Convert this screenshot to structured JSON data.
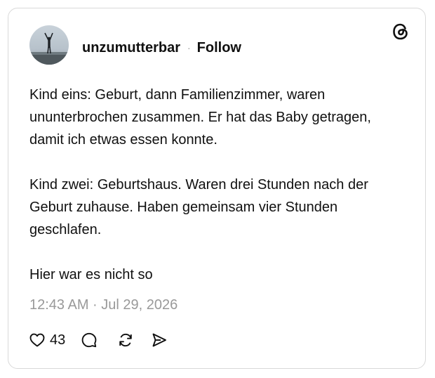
{
  "post": {
    "username": "unzumutterbar",
    "separator": "·",
    "follow_label": "Follow",
    "paragraphs": [
      "Kind eins: Geburt, dann Familienzimmer, waren ununterbrochen zusammen. Er hat das Baby getragen, damit ich etwas essen konnte.",
      "Kind zwei: Geburtshaus. Waren drei Stunden nach der Geburt zuhause. Haben gemeinsam vier Stunden geschlafen.",
      "Hier war es nicht so"
    ],
    "timestamp": "12:43 AM · Jul 29, 2026",
    "like_count": "43"
  },
  "icons": {
    "brand": "threads-logo-icon",
    "like": "heart-icon",
    "reply": "comment-icon",
    "repost": "repost-icon",
    "share": "send-icon"
  },
  "colors": {
    "text": "#101010",
    "muted": "#999999",
    "border": "#d9d9d9"
  }
}
